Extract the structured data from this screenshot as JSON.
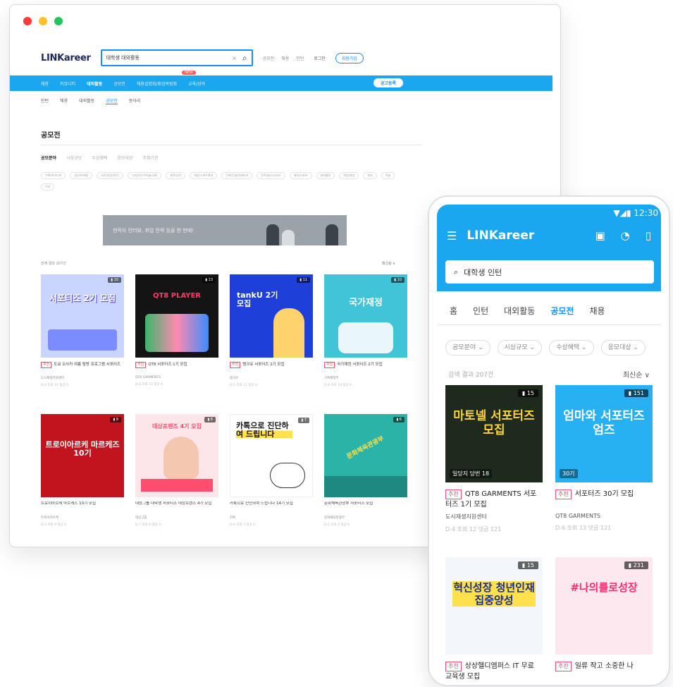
{
  "window": {
    "colors": [
      "#ff3b3b",
      "#ffbf2e",
      "#22c55e"
    ]
  },
  "desktop": {
    "logo": "LINKareer",
    "search_value": "대학생 대외활동",
    "util_links": [
      "공모전",
      "채용",
      "인턴"
    ],
    "login": "로그인",
    "signup": "회원가입",
    "nav": [
      "채용",
      "커뮤니티",
      "대외활동",
      "공모전",
      "채용설명회/취업박람회",
      "교육/강의"
    ],
    "nav_badge": "NEW",
    "register_btn": "공고등록",
    "subnav": [
      "인턴",
      "채용",
      "대외활동",
      "공모전",
      "동아리"
    ],
    "page_title": "공모전",
    "filters": [
      "공모분야",
      "시상규모",
      "수상혜택",
      "응모대상",
      "주최기관"
    ],
    "chips": [
      "기획/아이디어",
      "광고/마케팅",
      "사진/영상/UCC",
      "디자인/순수미술/공예",
      "과학/공학",
      "게임/소프트웨어",
      "건축/건설/인테리어",
      "문학/글/시나리오",
      "체육/스포츠",
      "대외활동",
      "취업/창업",
      "봉사",
      "학술",
      "기타"
    ],
    "banner_text": "현직자 인터뷰, 취업 전략 등을 한 번에!",
    "count": "전체 결과 207건",
    "sort": "최신순",
    "cards": [
      {
        "tag": "추천",
        "title": "도쿄 오사카 여름 탐방 프로그램 서포터즈",
        "org": "도시재생지원센터",
        "meta": "D-4 조회 12 댓글 0"
      },
      {
        "tag": "추천",
        "title": "QT8 서포터즈 1기 모집",
        "org": "QT8 GARMENTS",
        "meta": "D-6 조회 13 댓글 0"
      },
      {
        "tag": "추천",
        "title": "탱크유 서포터즈 2기 모집",
        "org": "탱크유",
        "meta": "D-5 조회 11 댓글 0"
      },
      {
        "tag": "추천",
        "title": "국가재정 서포터즈 2기 모집",
        "org": "기획재정부",
        "meta": "D-8 조회 10 댓글 0"
      },
      {
        "tag": "",
        "title": "트로이아르케 마르케즈 10기 모집",
        "org": "트로이아르케",
        "meta": "D-3 조회 9 댓글 0"
      },
      {
        "tag": "",
        "title": "대상그룹 대학생 서포터즈 데상프렌즈 4기 모집",
        "org": "대상그룹",
        "meta": "D-7 조회 8 댓글 0"
      },
      {
        "tag": "",
        "title": "카톡으로 진단하여 드립니다 14기 모집",
        "org": "카톡",
        "meta": "D-6 조회 7 댓글 0"
      },
      {
        "tag": "",
        "title": "문화체육관광부 서포터즈 모집",
        "org": "문화체육관광부",
        "meta": "D-2 조회 6 댓글 0"
      }
    ],
    "card_texts": [
      "서포터즈 2기 모집",
      "QT8 PLAYER",
      "tankU 2기 모집",
      "국가재정",
      "트로이아르케 마르케즈 10기",
      "데상프렌즈 4기 모집",
      "카톡으로 진단하여 드립니다",
      "문화체육관광부"
    ]
  },
  "phone": {
    "status": "▼◢▮ 12:30",
    "logo": "LINKareer",
    "search_placeholder": "대학생 인턴",
    "tabs": [
      "홈",
      "인턴",
      "대외활동",
      "공모전",
      "채용"
    ],
    "filters": [
      "공모분야 ⌄",
      "시상규모 ⌄",
      "수상혜택 ⌄",
      "응모대상 ⌄"
    ],
    "count": "검색 결과 207건",
    "sort": "최신순 ∨",
    "cards": [
      {
        "tag": "추천",
        "title": "QT8 GARMENTS 서포터즈 1기 모집",
        "org": "도시재생지원센터",
        "meta": "D-4 조회 12 댓글 121",
        "bookmark": "15",
        "thumb_text": "마토넬 서포터즈 모집",
        "thumb_sub": "일당지 당번 18",
        "thumb_color": "#1f2a1e"
      },
      {
        "tag": "추천",
        "title": "서포터즈 30기 모집",
        "org": "QT8 GARMENTS",
        "meta": "D-6 조회 13 댓글 121",
        "bookmark": "151",
        "thumb_text": "엄마와 서포터즈 엄즈",
        "thumb_sub": "30기",
        "thumb_color": "#27b1f2"
      },
      {
        "tag": "추천",
        "title": "상상헬디엠퍼스 IT 무료 교육생 모집",
        "org": "",
        "meta": "",
        "bookmark": "15",
        "thumb_text": "혁신성장 청년인재 집중양성",
        "thumb_sub": "",
        "thumb_color": "#f3f7fb"
      },
      {
        "tag": "추천",
        "title": "일류 작고 소중한 나",
        "org": "",
        "meta": "",
        "bookmark": "231",
        "thumb_text": "#나의를로성장",
        "thumb_sub": "",
        "thumb_color": "#fde8ef"
      }
    ]
  }
}
